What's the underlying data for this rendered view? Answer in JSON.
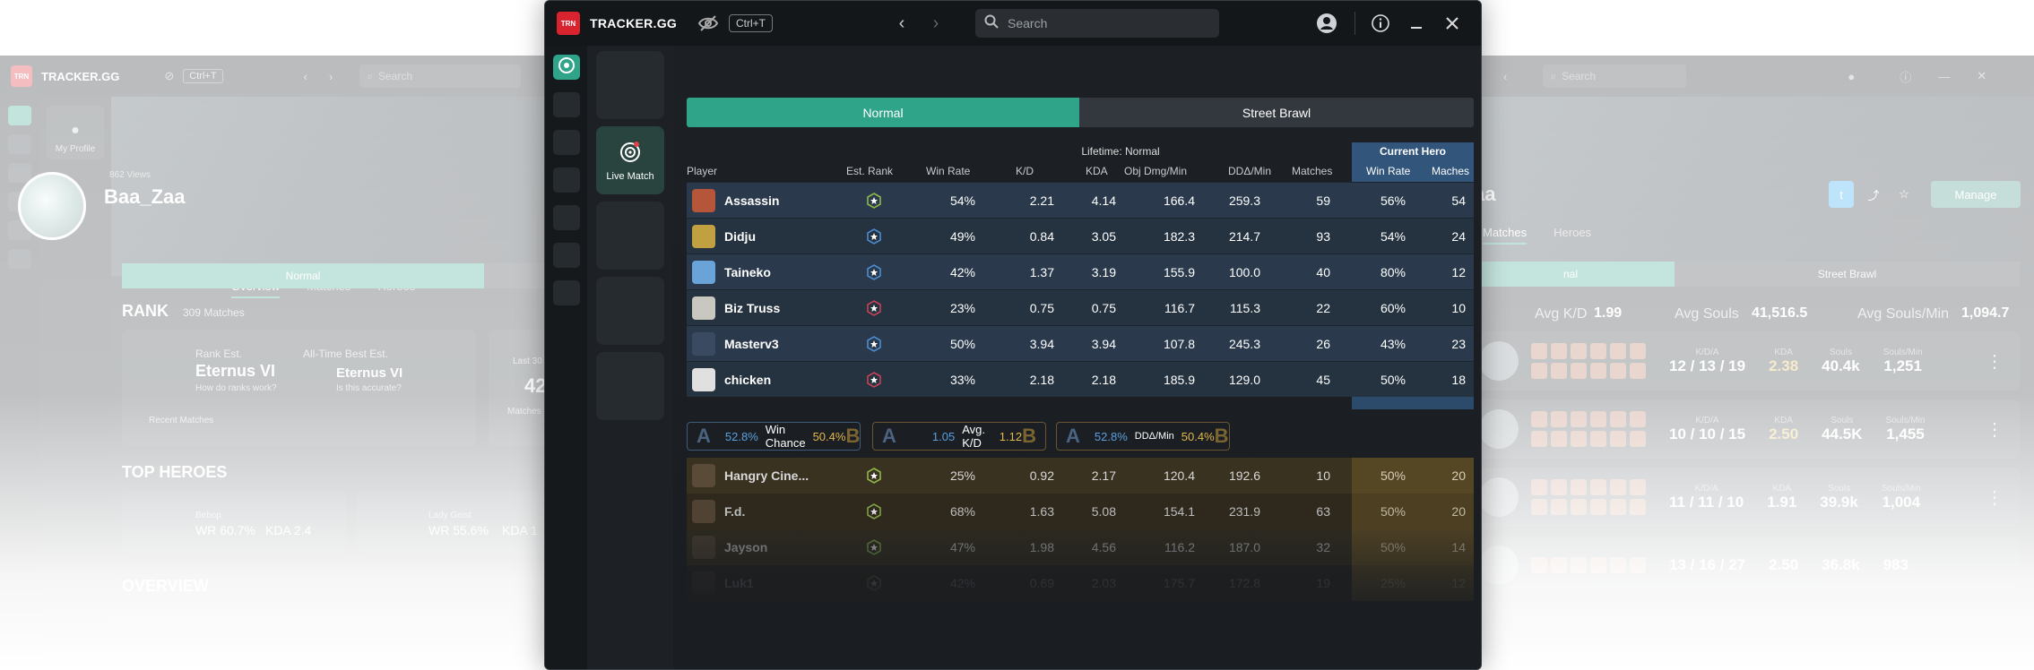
{
  "app": {
    "brand": "TRACKER.GG",
    "logo_text": "TRN",
    "shortcut": "Ctrl+T",
    "search_placeholder": "Search"
  },
  "background_left": {
    "brand": "TRACKER.GG",
    "shortcut": "Ctrl+T",
    "search": "Search",
    "nav_label": "My Profile",
    "views": "862 Views",
    "username": "Baa_Zaa",
    "tabs": [
      "Overview",
      "Matches",
      "Heroes"
    ],
    "seg_normal": "Normal",
    "rank_title": "RANK",
    "rank_matches": "309 Matches",
    "rank_est_label": "Rank Est.",
    "rank_est_value": "Eternus VI",
    "rank_hint": "How do ranks work?",
    "best_label": "All-Time Best Est.",
    "best_value": "Eternus VI",
    "best_hint": "Is this accurate?",
    "recent_label": "Recent Matches",
    "last_label": "Last 30 Days",
    "last_value": "42",
    "matches_label": "Matches",
    "top_heroes": "TOP HEROES",
    "hero1_name": "Bebop",
    "hero1_wr": "WR 60.7%",
    "hero1_kda": "KDA 2.4",
    "hero2_name": "Lady Geist",
    "hero2_wr": "WR 55.6%",
    "hero2_kda": "KDA 1",
    "overview": "OVERVIEW"
  },
  "background_right": {
    "search": "Search",
    "username_partial": "aa",
    "manage": "Manage",
    "tab_matches": "Matches",
    "tab_heroes": "Heroes",
    "seg_normal": "nal",
    "seg_street": "Street Brawl",
    "avg_kd_label": "Avg K/D",
    "avg_kd": "1.99",
    "avg_souls_label": "Avg Souls",
    "avg_souls": "41,516.5",
    "avg_souls_min_label": "Avg Souls/Min",
    "avg_souls_min": "1,094.7",
    "stat_labels": [
      "K/D/A",
      "KDA",
      "Souls",
      "Souls/Min"
    ],
    "matches": [
      {
        "kda_line": "12 / 13 / 19",
        "kda": "2.38",
        "souls": "40.4k",
        "spm": "1,251"
      },
      {
        "kda_line": "10 / 10 / 15",
        "kda": "2.50",
        "souls": "44.5K",
        "spm": "1,455"
      },
      {
        "kda_line": "11 / 11 / 10",
        "kda": "1.91",
        "souls": "39.9k",
        "spm": "1,004"
      },
      {
        "kda_line": "13 / 16 / 27",
        "kda": "2.50",
        "souls": "36.8k",
        "spm": "983"
      }
    ]
  },
  "sidebar": {
    "live_match_label": "Live Match"
  },
  "mode_tabs": {
    "normal": "Normal",
    "street_brawl": "Street Brawl"
  },
  "table": {
    "group_lifetime": "Lifetime: Normal",
    "group_current": "Current Hero",
    "headers": {
      "player": "Player",
      "est_rank": "Est. Rank",
      "win_rate": "Win Rate",
      "kd": "K/D",
      "kda": "KDA",
      "obj_dmg": "Obj Dmg/Min",
      "dd": "DDΔ/Min",
      "matches": "Matches",
      "cur_win_rate": "Win Rate",
      "cur_matches": "Maches"
    },
    "team_a": [
      {
        "name": "Assassin",
        "wr": "54%",
        "kd": "2.21",
        "kda": "4.14",
        "obj": "166.4",
        "dd": "259.3",
        "matches": "59",
        "cwr": "56%",
        "cm": "54",
        "hero_color": "#b5553a",
        "rank_color": "#8fb84a"
      },
      {
        "name": "Didju",
        "wr": "49%",
        "kd": "0.84",
        "kda": "3.05",
        "obj": "182.3",
        "dd": "214.7",
        "matches": "93",
        "cwr": "54%",
        "cm": "24",
        "hero_color": "#c0a040",
        "rank_color": "#4a8cd0"
      },
      {
        "name": "Taineko",
        "wr": "42%",
        "kd": "1.37",
        "kda": "3.19",
        "obj": "155.9",
        "dd": "100.0",
        "matches": "40",
        "cwr": "80%",
        "cm": "12",
        "hero_color": "#6aa3d8",
        "rank_color": "#4a8cd0"
      },
      {
        "name": "Biz Truss",
        "wr": "23%",
        "kd": "0.75",
        "kda": "0.75",
        "obj": "116.7",
        "dd": "115.3",
        "matches": "22",
        "cwr": "60%",
        "cm": "10",
        "hero_color": "#c8c8c0",
        "rank_color": "#c8405a"
      },
      {
        "name": "Masterv3",
        "wr": "50%",
        "kd": "3.94",
        "kda": "3.94",
        "obj": "107.8",
        "dd": "245.3",
        "matches": "26",
        "cwr": "43%",
        "cm": "23",
        "hero_color": "#3a4a60",
        "rank_color": "#4a8cd0"
      },
      {
        "name": "chicken",
        "wr": "33%",
        "kd": "2.18",
        "kda": "2.18",
        "obj": "185.9",
        "dd": "129.0",
        "matches": "45",
        "cwr": "50%",
        "cm": "18",
        "hero_color": "#e0e0e0",
        "rank_color": "#c8405a"
      }
    ],
    "compare": [
      {
        "a_letter": "A",
        "a_val": "52.8%",
        "label": "Win Chance",
        "b_val": "50.4%",
        "b_letter": "B"
      },
      {
        "a_letter": "A",
        "a_val": "1.05",
        "label": "Avg. K/D",
        "b_val": "1.12",
        "b_letter": "B"
      },
      {
        "a_letter": "A",
        "a_val": "52.8%",
        "label": "DDΔ/Min",
        "b_val": "50.4%",
        "b_letter": "B"
      }
    ],
    "team_b": [
      {
        "name": "Hangry Cine...",
        "wr": "25%",
        "kd": "0.92",
        "kda": "2.17",
        "obj": "120.4",
        "dd": "192.6",
        "matches": "10",
        "cwr": "50%",
        "cm": "20"
      },
      {
        "name": "F.d.",
        "wr": "68%",
        "kd": "1.63",
        "kda": "5.08",
        "obj": "154.1",
        "dd": "231.9",
        "matches": "63",
        "cwr": "50%",
        "cm": "20"
      },
      {
        "name": "Jayson",
        "wr": "47%",
        "kd": "1.98",
        "kda": "4.56",
        "obj": "116.2",
        "dd": "187.0",
        "matches": "32",
        "cwr": "50%",
        "cm": "14"
      },
      {
        "name": "Luk1",
        "wr": "42%",
        "kd": "0.69",
        "kda": "2.03",
        "obj": "175.7",
        "dd": "172.8",
        "matches": "19",
        "cwr": "25%",
        "cm": "12"
      }
    ]
  },
  "colors": {
    "accent": "#2fa489",
    "current_hero_bg": "#2c4a6a",
    "team_b_bg": "#3a3220",
    "team_b_accent": "#d8a43a",
    "team_a_accent": "#5aa0e0"
  }
}
